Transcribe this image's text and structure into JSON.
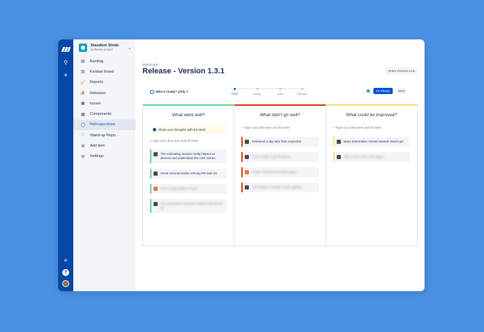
{
  "nav": {
    "bottom_help": "?"
  },
  "project": {
    "name": "Standbot Stride",
    "type": "Software project"
  },
  "sidebar": {
    "items": [
      {
        "label": "Backlog",
        "icon": "▤",
        "active": false
      },
      {
        "label": "Kanban board",
        "icon": "▥",
        "active": false
      },
      {
        "label": "Reports",
        "icon": "📈",
        "active": false
      },
      {
        "label": "Releases",
        "icon": "⛵",
        "active": false
      },
      {
        "label": "Issues",
        "icon": "▣",
        "active": false
      },
      {
        "label": "Components",
        "icon": "▦",
        "active": false
      },
      {
        "label": "Retrospectives",
        "icon": "◯",
        "active": true
      },
      {
        "label": "Stand-up Repo...",
        "icon": "♡",
        "active": false
      },
      {
        "label": "Add item",
        "icon": "⊞",
        "active": false
      },
      {
        "label": "Settings",
        "icon": "⚙",
        "active": false
      }
    ]
  },
  "header": {
    "breadcrumb": "Dashboard",
    "title": "Release - Version 1.3.1",
    "share_label": "Share Session Link"
  },
  "controls": {
    "whos_ready": "Who's ready? (2/3)",
    "steps": [
      {
        "label": "Think",
        "active": true
      },
      {
        "label": "Group",
        "active": false
      },
      {
        "label": "Vote",
        "active": false
      },
      {
        "label": "Discuss",
        "active": false
      }
    ],
    "ready_label": "I'm Ready",
    "next_label": "Next"
  },
  "columns": [
    {
      "title": "What went well?",
      "color": "#57d9a3",
      "hint": "Share your thoughts with the team",
      "add_placeholder": "+ Type your idea here and hit enter",
      "cards": [
        {
          "text": "The estimating session really helped us discuss and understand the user stories",
          "blurred": false
        },
        {
          "text": "Great communication among PM and UX",
          "blurred": false
        },
        {
          "text": "Demo ready ahead of time",
          "blurred": true
        },
        {
          "text": "The new branch structure worked well across all",
          "blurred": true
        }
      ]
    },
    {
      "title": "What didn't go well?",
      "color": "#de350b",
      "hint": "",
      "add_placeholder": "+ Type your idea here and hit enter",
      "cards": [
        {
          "text": "Released a day later than expected",
          "blurred": false
        },
        {
          "text": "It was tough to get feedback",
          "blurred": true
        },
        {
          "text": "Scope changed mid sprint again",
          "blurred": true
        },
        {
          "text": "The release checklist needs updates",
          "blurred": true
        }
      ]
    },
    {
      "title": "What could be improved?",
      "color": "#ffe380",
      "hint": "",
      "add_placeholder": "+ Type your idea here and hit enter",
      "cards": [
        {
          "text": "Many teammates missed several stand-ups",
          "blurred": false
        },
        {
          "text": "Take a look at the new pages",
          "blurred": true
        }
      ]
    }
  ]
}
